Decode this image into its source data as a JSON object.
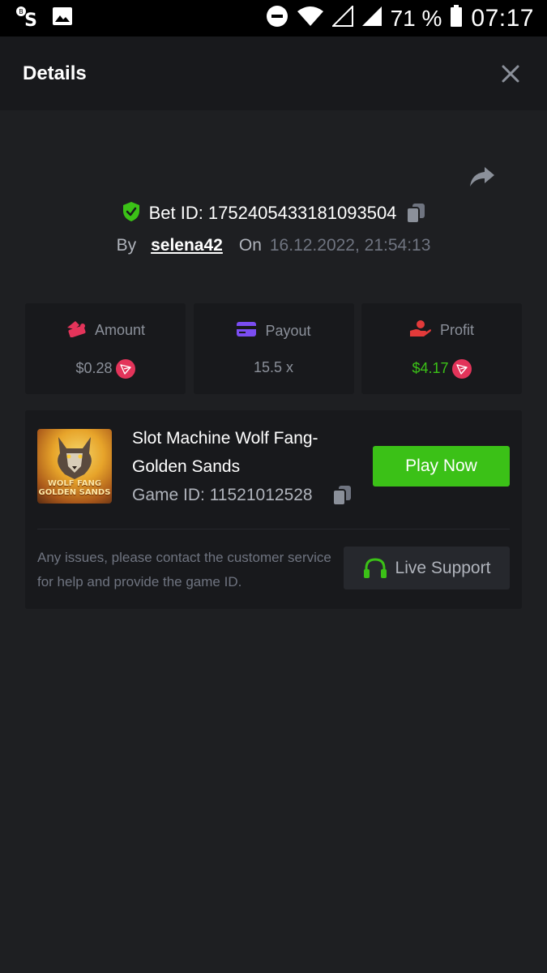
{
  "status_bar": {
    "app_icon_1": "bs-app-icon",
    "app_icon_2": "image-icon",
    "battery_percent": "71 %",
    "time": "07:17"
  },
  "header": {
    "title": "Details"
  },
  "bet": {
    "id_label": "Bet ID: 1752405433181093504",
    "by_label": "By",
    "user": "selena42",
    "on_label": "On",
    "date": "16.12.2022, 21:54:13"
  },
  "stats": {
    "amount": {
      "label": "Amount",
      "value": "$0.28"
    },
    "payout": {
      "label": "Payout",
      "value": "15.5 x"
    },
    "profit": {
      "label": "Profit",
      "value": "$4.17"
    }
  },
  "game": {
    "title": "Slot Machine Wolf Fang-Golden Sands",
    "thumb_title_line1": "WOLF FANG",
    "thumb_title_line2": "GOLDEN SANDS",
    "id_label": "Game ID: 11521012528",
    "play_label": "Play Now",
    "support_text": "Any issues, please contact the customer service for help and provide the game ID.",
    "support_label": "Live Support"
  },
  "colors": {
    "accent_green": "#3bc117",
    "tron_red": "#e3345a",
    "payout_purple": "#7b4df2"
  }
}
